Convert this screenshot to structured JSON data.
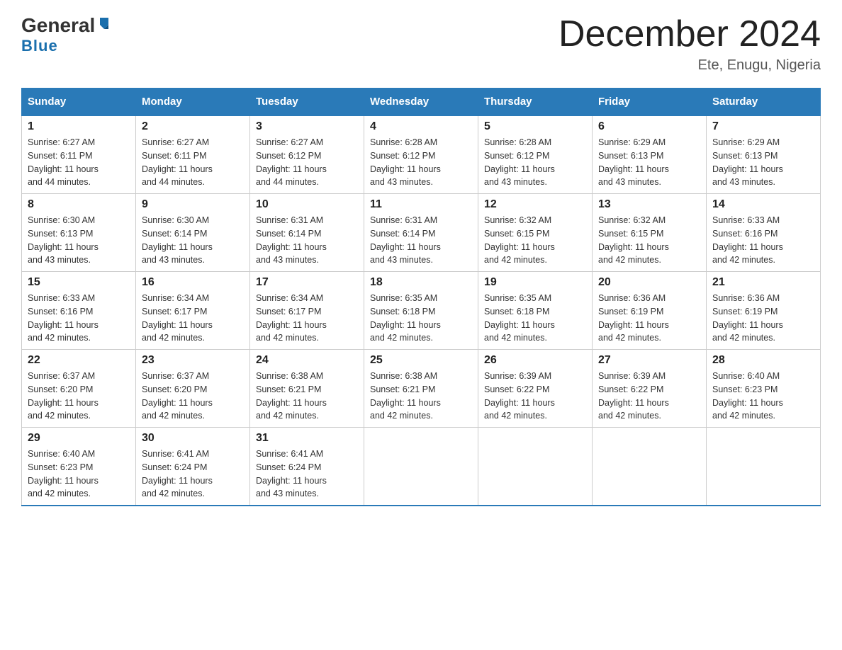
{
  "header": {
    "logo_general": "General",
    "logo_blue": "Blue",
    "month_title": "December 2024",
    "location": "Ete, Enugu, Nigeria"
  },
  "weekdays": [
    "Sunday",
    "Monday",
    "Tuesday",
    "Wednesday",
    "Thursday",
    "Friday",
    "Saturday"
  ],
  "weeks": [
    [
      {
        "day": "1",
        "sunrise": "6:27 AM",
        "sunset": "6:11 PM",
        "daylight": "11 hours and 44 minutes."
      },
      {
        "day": "2",
        "sunrise": "6:27 AM",
        "sunset": "6:11 PM",
        "daylight": "11 hours and 44 minutes."
      },
      {
        "day": "3",
        "sunrise": "6:27 AM",
        "sunset": "6:12 PM",
        "daylight": "11 hours and 44 minutes."
      },
      {
        "day": "4",
        "sunrise": "6:28 AM",
        "sunset": "6:12 PM",
        "daylight": "11 hours and 43 minutes."
      },
      {
        "day": "5",
        "sunrise": "6:28 AM",
        "sunset": "6:12 PM",
        "daylight": "11 hours and 43 minutes."
      },
      {
        "day": "6",
        "sunrise": "6:29 AM",
        "sunset": "6:13 PM",
        "daylight": "11 hours and 43 minutes."
      },
      {
        "day": "7",
        "sunrise": "6:29 AM",
        "sunset": "6:13 PM",
        "daylight": "11 hours and 43 minutes."
      }
    ],
    [
      {
        "day": "8",
        "sunrise": "6:30 AM",
        "sunset": "6:13 PM",
        "daylight": "11 hours and 43 minutes."
      },
      {
        "day": "9",
        "sunrise": "6:30 AM",
        "sunset": "6:14 PM",
        "daylight": "11 hours and 43 minutes."
      },
      {
        "day": "10",
        "sunrise": "6:31 AM",
        "sunset": "6:14 PM",
        "daylight": "11 hours and 43 minutes."
      },
      {
        "day": "11",
        "sunrise": "6:31 AM",
        "sunset": "6:14 PM",
        "daylight": "11 hours and 43 minutes."
      },
      {
        "day": "12",
        "sunrise": "6:32 AM",
        "sunset": "6:15 PM",
        "daylight": "11 hours and 42 minutes."
      },
      {
        "day": "13",
        "sunrise": "6:32 AM",
        "sunset": "6:15 PM",
        "daylight": "11 hours and 42 minutes."
      },
      {
        "day": "14",
        "sunrise": "6:33 AM",
        "sunset": "6:16 PM",
        "daylight": "11 hours and 42 minutes."
      }
    ],
    [
      {
        "day": "15",
        "sunrise": "6:33 AM",
        "sunset": "6:16 PM",
        "daylight": "11 hours and 42 minutes."
      },
      {
        "day": "16",
        "sunrise": "6:34 AM",
        "sunset": "6:17 PM",
        "daylight": "11 hours and 42 minutes."
      },
      {
        "day": "17",
        "sunrise": "6:34 AM",
        "sunset": "6:17 PM",
        "daylight": "11 hours and 42 minutes."
      },
      {
        "day": "18",
        "sunrise": "6:35 AM",
        "sunset": "6:18 PM",
        "daylight": "11 hours and 42 minutes."
      },
      {
        "day": "19",
        "sunrise": "6:35 AM",
        "sunset": "6:18 PM",
        "daylight": "11 hours and 42 minutes."
      },
      {
        "day": "20",
        "sunrise": "6:36 AM",
        "sunset": "6:19 PM",
        "daylight": "11 hours and 42 minutes."
      },
      {
        "day": "21",
        "sunrise": "6:36 AM",
        "sunset": "6:19 PM",
        "daylight": "11 hours and 42 minutes."
      }
    ],
    [
      {
        "day": "22",
        "sunrise": "6:37 AM",
        "sunset": "6:20 PM",
        "daylight": "11 hours and 42 minutes."
      },
      {
        "day": "23",
        "sunrise": "6:37 AM",
        "sunset": "6:20 PM",
        "daylight": "11 hours and 42 minutes."
      },
      {
        "day": "24",
        "sunrise": "6:38 AM",
        "sunset": "6:21 PM",
        "daylight": "11 hours and 42 minutes."
      },
      {
        "day": "25",
        "sunrise": "6:38 AM",
        "sunset": "6:21 PM",
        "daylight": "11 hours and 42 minutes."
      },
      {
        "day": "26",
        "sunrise": "6:39 AM",
        "sunset": "6:22 PM",
        "daylight": "11 hours and 42 minutes."
      },
      {
        "day": "27",
        "sunrise": "6:39 AM",
        "sunset": "6:22 PM",
        "daylight": "11 hours and 42 minutes."
      },
      {
        "day": "28",
        "sunrise": "6:40 AM",
        "sunset": "6:23 PM",
        "daylight": "11 hours and 42 minutes."
      }
    ],
    [
      {
        "day": "29",
        "sunrise": "6:40 AM",
        "sunset": "6:23 PM",
        "daylight": "11 hours and 42 minutes."
      },
      {
        "day": "30",
        "sunrise": "6:41 AM",
        "sunset": "6:24 PM",
        "daylight": "11 hours and 42 minutes."
      },
      {
        "day": "31",
        "sunrise": "6:41 AM",
        "sunset": "6:24 PM",
        "daylight": "11 hours and 43 minutes."
      },
      null,
      null,
      null,
      null
    ]
  ],
  "labels": {
    "sunrise": "Sunrise:",
    "sunset": "Sunset:",
    "daylight": "Daylight:"
  }
}
